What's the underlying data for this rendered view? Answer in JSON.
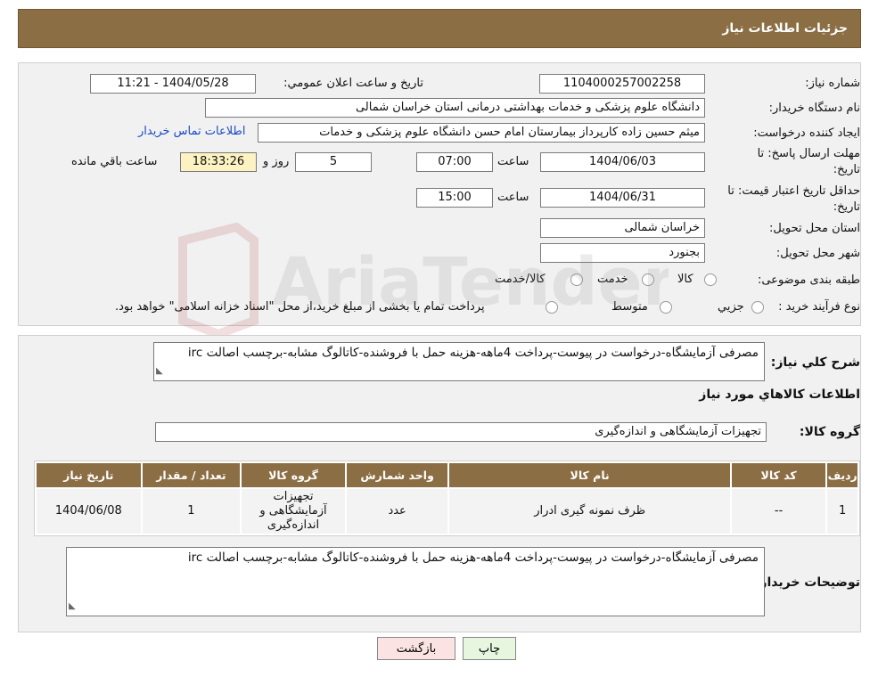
{
  "header": {
    "title": "جزئیات اطلاعات نیاز"
  },
  "fields": {
    "need_number_label": "شماره نیاز:",
    "need_number": "1104000257002258",
    "announce_label": "تاریخ و ساعت اعلان عمومي:",
    "announce_value": "1404/05/28 - 11:21",
    "buyer_org_label": "نام دستگاه خريدار:",
    "buyer_org": "دانشگاه علوم پزشکی و خدمات بهداشتی درمانی استان خراسان شمالی",
    "creator_label": "ايجاد کننده درخواست:",
    "creator": "میثم  حسین زاده  کارپرداز بیمارستان امام حسن دانشگاه علوم پزشکی و خدمات",
    "contact_link": "اطلاعات تماس خريدار",
    "deadline_label_1": "مهلت ارسال پاسخ: تا",
    "deadline_label_2": "تاريخ:",
    "deadline_date": "1404/06/03",
    "time_label": "ساعت",
    "deadline_time": "07:00",
    "days_value": "5",
    "days_label": "روز و",
    "remaining_time": "18:33:26",
    "remaining_label": "ساعت باقي مانده",
    "validity_label_1": "حداقل تاريخ اعتبار قيمت: تا",
    "validity_label_2": "تاريخ:",
    "validity_date": "1404/06/31",
    "validity_time": "15:00",
    "province_label": "استان محل تحويل:",
    "province": "خراسان شمالی",
    "city_label": "شهر محل تحويل:",
    "city": "بجنورد",
    "category_label": "طبقه بندی موضوعی:",
    "category_options": [
      "کالا",
      "خدمت",
      "کالا/خدمت"
    ],
    "process_label": "نوع فرآيند خريد :",
    "process_options": [
      "جزيي",
      "متوسط"
    ],
    "process_note": "پرداخت تمام يا بخشی از مبلغ خريد،از محل \"اسناد خزانه اسلامی\" خواهد بود."
  },
  "summary": {
    "label": "شرح کلي نياز:",
    "text": "مصرفی آزمایشگاه-درخواست در پیوست-پرداخت 4ماهه-هزینه حمل با فروشنده-کاتالوگ مشابه-برچسب اصالت irc"
  },
  "goods_section": {
    "title": "اطلاعات کالاهاي مورد نياز",
    "group_label": "گروه کالا:",
    "group_value": "تجهیزات آزمایشگاهی و اندازه‌گیری"
  },
  "table": {
    "headers": [
      "رديف",
      "کد کالا",
      "نام کالا",
      "واحد شمارش",
      "گروه کالا",
      "تعداد / مقدار",
      "تاريخ نياز"
    ],
    "rows": [
      [
        "1",
        "--",
        "ظرف نمونه گیری ادرار",
        "عدد",
        "تجهيزات آزمايشگاهی و اندازه‌گيری",
        "1",
        "1404/06/08"
      ]
    ]
  },
  "buyer_notes": {
    "label": "توضيحات خريدار:",
    "text": "مصرفی آزمایشگاه-درخواست در پیوست-پرداخت 4ماهه-هزینه حمل با فروشنده-کاتالوگ مشابه-برچسب اصالت irc"
  },
  "buttons": {
    "print": "چاپ",
    "back": "بازگشت"
  },
  "colors": {
    "header_bg": "#8b6e44",
    "link": "#1a49c9",
    "back_button_bg": "#fbe3e3",
    "print_button_bg": "#e6f6df"
  },
  "watermark": {
    "text": "AriaTender.neT"
  }
}
